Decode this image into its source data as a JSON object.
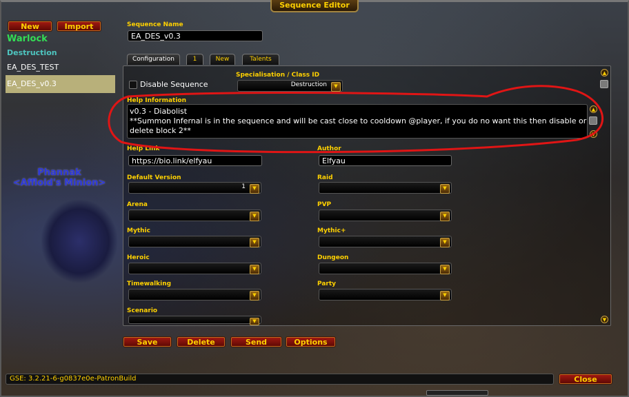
{
  "title": "Sequence Editor",
  "left": {
    "new_label": "New",
    "import_label": "Import",
    "class_name": "Warlock",
    "spec_name": "Destruction",
    "sequences": [
      "EA_DES_TEST",
      "EA_DES_v0.3"
    ],
    "selected_index": 1
  },
  "npc": {
    "name": "Phannak",
    "title": "<Affloid's Minion>"
  },
  "sequence_name_label": "Sequence Name",
  "sequence_name_value": "EA_DES_v0.3",
  "tabs": [
    "Configuration",
    "1",
    "New",
    "Talents"
  ],
  "config": {
    "disable_label": "Disable Sequence",
    "spec_label": "Specialisation / Class ID",
    "spec_value": "Destruction",
    "help_info_label": "Help Information",
    "help_lines": [
      "v0.3 - Diabolist",
      "**Summon Infernal is in the sequence and will be cast close to cooldown @player, if you do no want this then disable or",
      "delete block 2**"
    ],
    "help_link_label": "Help Link",
    "help_link_value": "https://bio.link/elfyau",
    "author_label": "Author",
    "author_value": "Elfyau",
    "fields_left": [
      {
        "label": "Default Version",
        "value": "1"
      },
      {
        "label": "Arena",
        "value": ""
      },
      {
        "label": "Mythic",
        "value": ""
      },
      {
        "label": "Heroic",
        "value": ""
      },
      {
        "label": "Timewalking",
        "value": ""
      },
      {
        "label": "Scenario",
        "value": ""
      }
    ],
    "fields_right": [
      {
        "label": "Raid",
        "value": ""
      },
      {
        "label": "PVP",
        "value": ""
      },
      {
        "label": "Mythic+",
        "value": ""
      },
      {
        "label": "Dungeon",
        "value": ""
      },
      {
        "label": "Party",
        "value": ""
      }
    ]
  },
  "bottom_buttons": [
    "Save",
    "Delete",
    "Send",
    "Options"
  ],
  "status_text": "GSE: 3.2.21-6-g0837e0e-PatronBuild",
  "close_label": "Close",
  "colors": {
    "gold": "#ffd100",
    "class_green": "#33dd55",
    "spec_teal": "#4ec6c0",
    "annotation_red": "#e01515"
  }
}
